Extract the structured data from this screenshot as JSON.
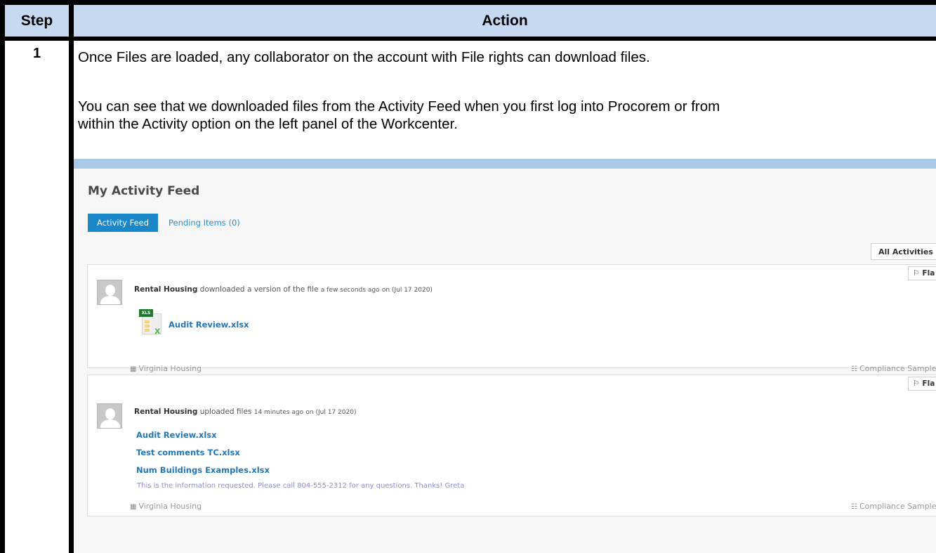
{
  "table": {
    "header_step": "Step",
    "header_action": "Action",
    "step_number": "1",
    "paragraph_1": "Once Files are loaded, any collaborator on the account with File rights can download files.",
    "paragraph_2_line_1": "You can see that we downloaded files from the Activity Feed when you first log into Procorem or from",
    "paragraph_2_line_2": "within the Activity option on the left panel of the Workcenter."
  },
  "feed": {
    "title": "My Activity Feed",
    "tabs": {
      "active": "Activity Feed",
      "pending": "Pending Items (0)"
    },
    "filter_label": "All Activities",
    "flag_label": "Fla",
    "activities": [
      {
        "actor": "Rental Housing",
        "action": "downloaded a version of the file",
        "ago": "a few seconds ago",
        "date": "on (Jul 17 2020)",
        "file_badge": "XLS",
        "file": "Audit Review.xlsx",
        "org": "Virginia Housing",
        "workcenter": "Compliance Sample WorkCenter"
      },
      {
        "actor": "Rental Housing",
        "action": "uploaded files",
        "ago": "14 minutes ago",
        "date": "on (Jul 17 2020)",
        "files": [
          "Audit Review.xlsx",
          "Test comments TC.xlsx",
          "Num Buildings Examples.xlsx"
        ],
        "note": "This is the information requested. Please call 804-555-2312 for any questions. Thanks! Greta",
        "org": "Virginia Housing",
        "workcenter": "Compliance Sample WorkCente"
      }
    ]
  }
}
